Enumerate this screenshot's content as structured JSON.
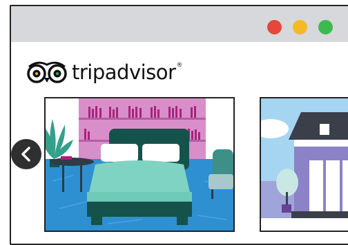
{
  "window": {
    "controls": [
      {
        "name": "close",
        "color": "#e8453c"
      },
      {
        "name": "minimize",
        "color": "#f5b921"
      },
      {
        "name": "maximize",
        "color": "#3dba4e"
      }
    ]
  },
  "brand": {
    "name": "tripadvisor",
    "trademark": "®",
    "logo_icon": "owl-eyes-icon"
  },
  "carousel": {
    "prev_icon": "chevron-left-icon",
    "items": [
      {
        "scene": "bedroom-illustration"
      },
      {
        "scene": "house-exterior-illustration"
      }
    ]
  },
  "colors": {
    "accent_green": "#33a852",
    "titlebar": "#d6d8dc"
  }
}
